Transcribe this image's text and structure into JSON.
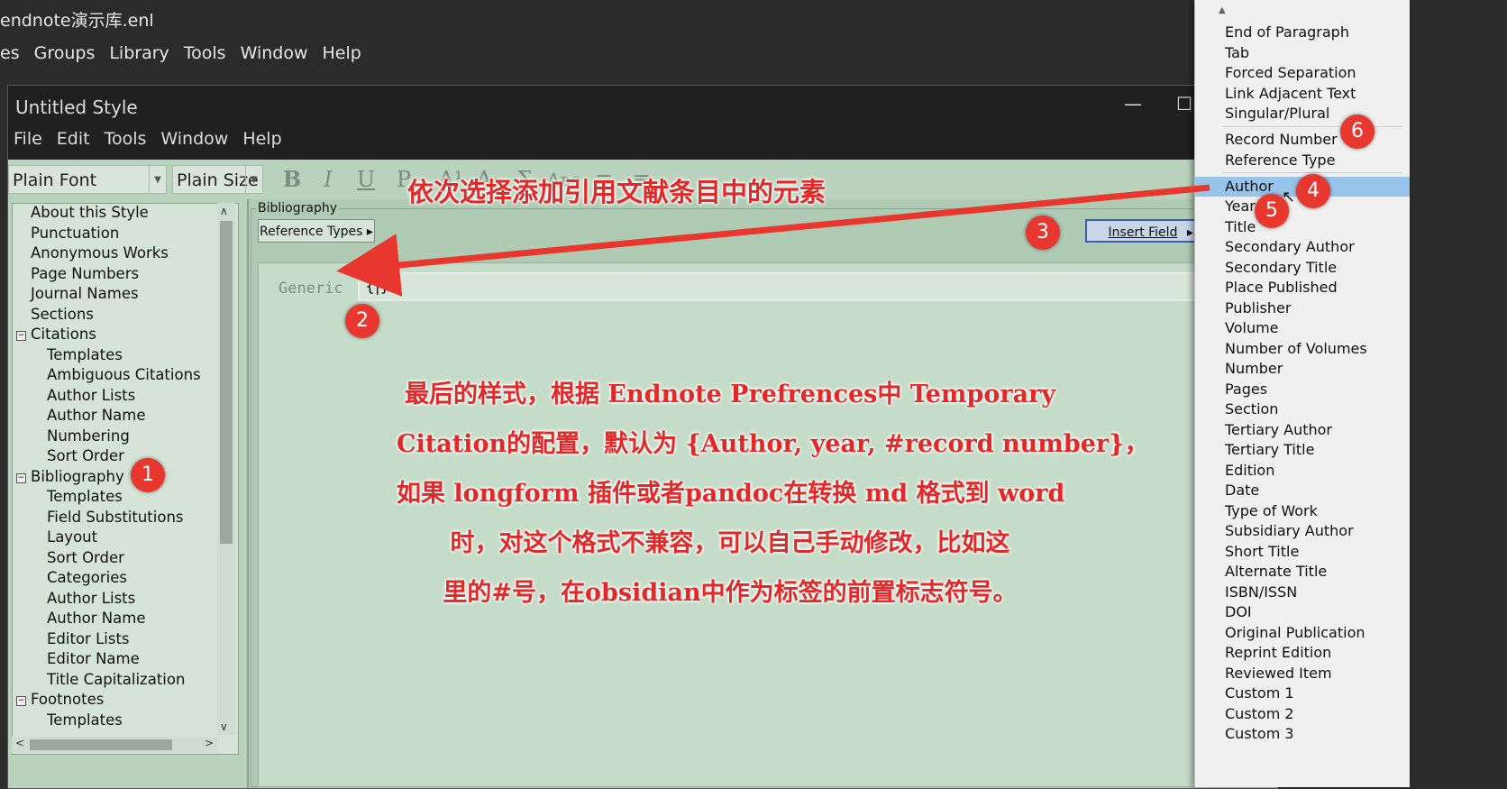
{
  "outer": {
    "title": "endnote演示库.enl",
    "menu": [
      "es",
      "Groups",
      "Library",
      "Tools",
      "Window",
      "Help"
    ]
  },
  "style_window": {
    "title": "Untitled Style",
    "controls": [
      "—",
      "☐",
      "✕"
    ],
    "menu": [
      "File",
      "Edit",
      "Tools",
      "Window",
      "Help"
    ],
    "toolbar": {
      "font": "Plain Font",
      "size": "Plain Size",
      "buttons": [
        "B",
        "I",
        "U",
        "P",
        "A¹",
        "A₁",
        "Σ",
        "Aʙᴄ",
        "≡",
        "≡"
      ]
    }
  },
  "tree": [
    {
      "label": "About this Style"
    },
    {
      "label": "Punctuation"
    },
    {
      "label": "Anonymous Works"
    },
    {
      "label": "Page Numbers"
    },
    {
      "label": "Journal Names"
    },
    {
      "label": "Sections"
    },
    {
      "label": "Citations",
      "expanded": true
    },
    {
      "label": "Templates"
    },
    {
      "label": "Ambiguous Citations"
    },
    {
      "label": "Author Lists"
    },
    {
      "label": "Author Name"
    },
    {
      "label": "Numbering"
    },
    {
      "label": "Sort Order"
    },
    {
      "label": "Bibliography",
      "expanded": true
    },
    {
      "label": "Templates"
    },
    {
      "label": "Field Substitutions"
    },
    {
      "label": "Layout"
    },
    {
      "label": "Sort Order"
    },
    {
      "label": "Categories"
    },
    {
      "label": "Author Lists"
    },
    {
      "label": "Author Name"
    },
    {
      "label": "Editor Lists"
    },
    {
      "label": "Editor Name"
    },
    {
      "label": "Title Capitalization"
    },
    {
      "label": "Footnotes",
      "expanded": true
    },
    {
      "label": "Templates"
    }
  ],
  "main": {
    "section_label": "Bibliography",
    "reference_types_btn": "Reference Types ▸",
    "insert_field_btn": "Insert Field",
    "insert_field_arrow": "▸",
    "generic_label": "Generic",
    "template_value": "{|}"
  },
  "annotations": {
    "top_note": "依次选择添加引用文献条目中的元素",
    "main_note": [
      "最后的样式，根据 Endnote Prefrences中 Temporary",
      "Citation的配置，默认为 {Author, year, #record number}，",
      "如果 longform 插件或者pandoc在转换 md 格式到 word",
      "时，对这个格式不兼容，可以自己手动修改，比如这",
      "里的#号，在obsidian中作为标签的前置标志符号。"
    ],
    "circles": [
      "1",
      "2",
      "3",
      "4",
      "5",
      "6"
    ],
    "arrow_color": "#e8372f"
  },
  "dropdown": {
    "items": [
      "End of Paragraph",
      "Tab",
      "Forced Separation",
      "Link Adjacent Text",
      "Singular/Plural",
      "Record Number",
      "Reference Type",
      "Author",
      "Year",
      "Title",
      "Secondary Author",
      "Secondary Title",
      "Place Published",
      "Publisher",
      "Volume",
      "Number of Volumes",
      "Number",
      "Pages",
      "Section",
      "Tertiary Author",
      "Tertiary Title",
      "Edition",
      "Date",
      "Type of Work",
      "Subsidiary Author",
      "Short Title",
      "Alternate Title",
      "ISBN/ISSN",
      "DOI",
      "Original Publication",
      "Reprint Edition",
      "Reviewed Item",
      "Custom 1",
      "Custom 2",
      "Custom 3"
    ],
    "selected": "Author"
  }
}
